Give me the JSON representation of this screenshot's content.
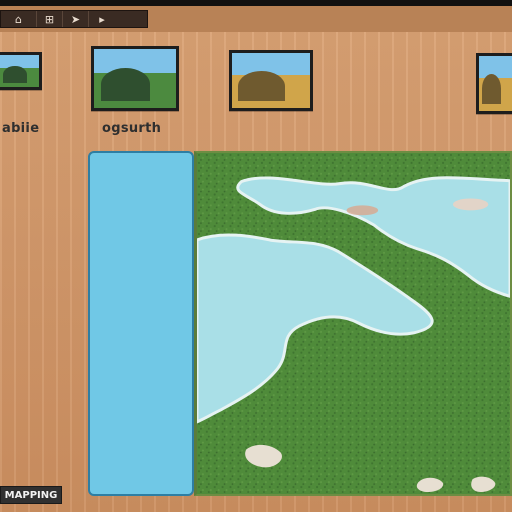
{
  "toolbar": {
    "buttons": [
      {
        "icon": "home-icon",
        "glyph": "⌂"
      },
      {
        "icon": "grid-icon",
        "glyph": "⊞"
      },
      {
        "icon": "cursor-icon",
        "glyph": "➤"
      },
      {
        "icon": "arrow-icon",
        "glyph": "▸"
      }
    ]
  },
  "thumbnails": [
    {
      "label": "abiie"
    },
    {
      "label": "ogsurth"
    },
    {
      "label": ""
    },
    {
      "label": ""
    }
  ],
  "statusbar": {
    "text": "MAPPING"
  },
  "colors": {
    "panel": "#d49a6a",
    "water": "#70c8e6",
    "terrain": "#4f8b3a"
  }
}
